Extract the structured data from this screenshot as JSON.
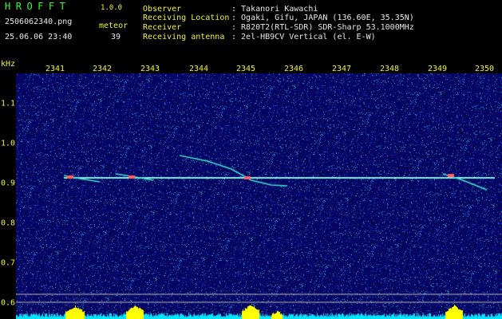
{
  "header": {
    "app_title": "HROFFT",
    "version": "1.0.0",
    "filename": "2506062340.png",
    "datetime": "25.06.06 23:40",
    "meteor_label": "meteor",
    "meteor_count": "39",
    "info": [
      {
        "key": "Observer",
        "value": ": Takanori Kawachi"
      },
      {
        "key": "Receiving Location",
        "value": ": Ogaki, Gifu, JAPAN (136.60E, 35.35N)"
      },
      {
        "key": "Receiver",
        "value": ": R820T2(RTL-SDR) SDR-Sharp 53.1000MHz"
      },
      {
        "key": "Receiving antenna",
        "value": ": 2el-HB9CV Vertical (el. E-W)"
      }
    ]
  },
  "spectrogram": {
    "y_unit": "kHz",
    "x_ticks": [
      "2341",
      "2342",
      "2343",
      "2344",
      "2345",
      "2346",
      "2347",
      "2348",
      "2349",
      "2350"
    ],
    "y_ticks": [
      "1.1",
      "1.0",
      "0.9",
      "0.8",
      "0.7",
      "0.6"
    ],
    "colors": {
      "noise_bg": "#0a0a6e",
      "carrier": "#40e0d0",
      "meteor": "#ff6060",
      "histogram": "#ffff00",
      "baseline": "#00e5ff"
    }
  }
}
